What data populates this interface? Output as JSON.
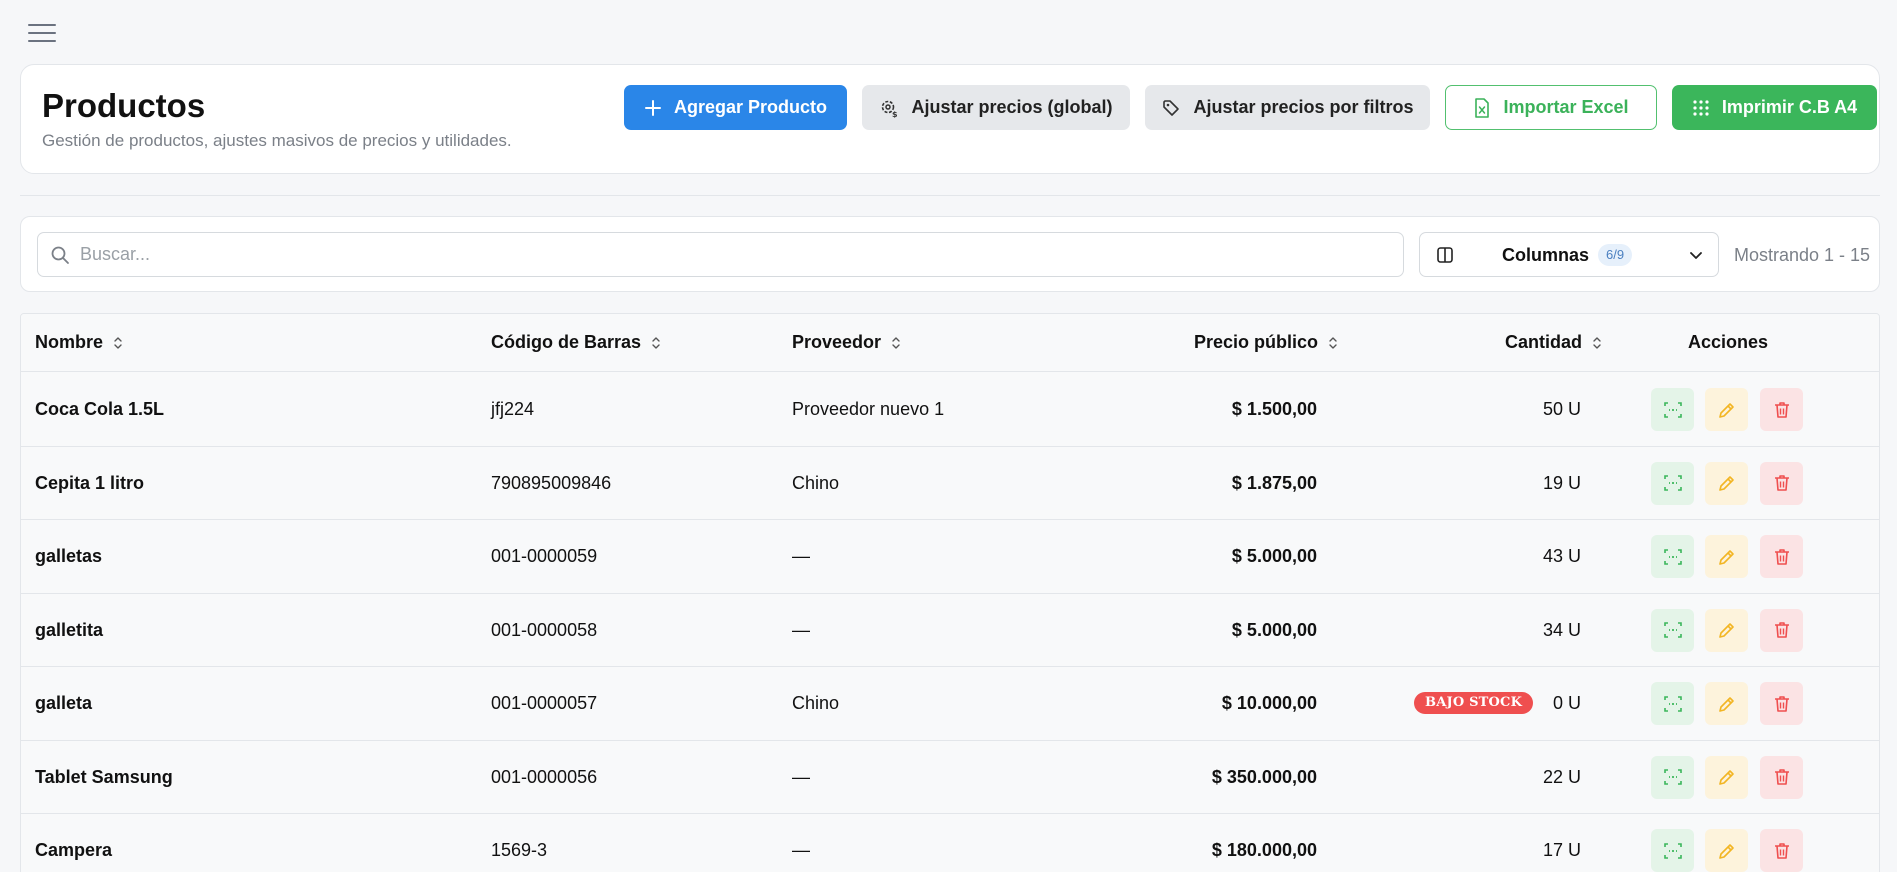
{
  "header": {
    "title": "Productos",
    "subtitle": "Gestión de productos, ajustes masivos de precios y utilidades.",
    "buttons": {
      "add": "Agregar Producto",
      "adjust_global": "Ajustar precios (global)",
      "adjust_filters": "Ajustar precios por filtros",
      "import_excel": "Importar Excel",
      "print_barcodes": "Imprimir C.B A4"
    }
  },
  "toolbar": {
    "search_placeholder": "Buscar...",
    "columns_label": "Columnas",
    "columns_badge": "6/9",
    "showing": "Mostrando 1 - 15"
  },
  "table": {
    "columns": {
      "name": "Nombre",
      "barcode": "Código de Barras",
      "provider": "Proveedor",
      "price": "Precio público",
      "quantity": "Cantidad",
      "actions": "Acciones"
    },
    "low_stock_label": "BAJO STOCK",
    "rows": [
      {
        "name": "Coca Cola 1.5L",
        "barcode": "jfj224",
        "provider": "Proveedor nuevo 1",
        "price": "$ 1.500,00",
        "quantity": "50 U"
      },
      {
        "name": "Cepita 1 litro",
        "barcode": "790895009846",
        "provider": "Chino",
        "price": "$ 1.875,00",
        "quantity": "19 U"
      },
      {
        "name": "galletas",
        "barcode": "001-0000059",
        "provider": "—",
        "price": "$ 5.000,00",
        "quantity": "43 U"
      },
      {
        "name": "galletita",
        "barcode": "001-0000058",
        "provider": "—",
        "price": "$ 5.000,00",
        "quantity": "34 U"
      },
      {
        "name": "galleta",
        "barcode": "001-0000057",
        "provider": "Chino",
        "price": "$ 10.000,00",
        "quantity": "0 U"
      },
      {
        "name": "Tablet Samsung",
        "barcode": "001-0000056",
        "provider": "—",
        "price": "$ 350.000,00",
        "quantity": "22 U"
      },
      {
        "name": "Campera",
        "barcode": "1569-3",
        "provider": "—",
        "price": "$ 180.000,00",
        "quantity": "17 U"
      }
    ]
  },
  "colors": {
    "primary": "#2a86e8",
    "success": "#3bb65b",
    "danger": "#ef4f4f",
    "warning": "#f2b523"
  },
  "icons": [
    "menu-icon",
    "plus-icon",
    "gear-dollar-icon",
    "tag-icon",
    "excel-file-icon",
    "grid-icon",
    "search-icon",
    "columns-icon",
    "chevron-down-icon",
    "sort-icon",
    "barcode-scan-icon",
    "pencil-icon",
    "trash-icon"
  ]
}
